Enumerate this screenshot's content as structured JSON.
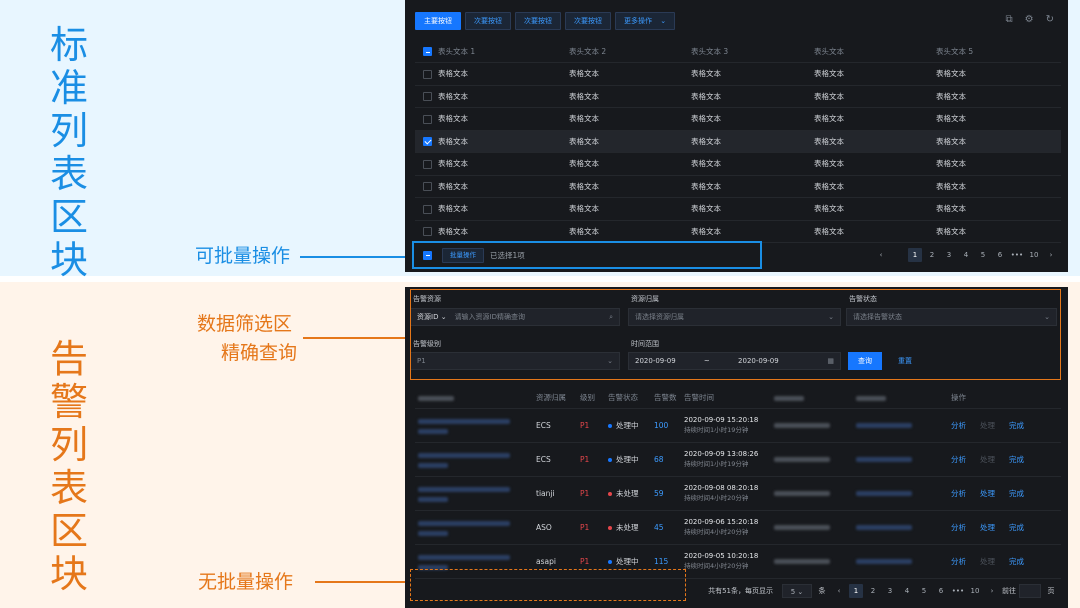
{
  "labels": {
    "standard_title": [
      "标",
      "准",
      "列",
      "表",
      "区",
      "块"
    ],
    "alert_title": [
      "告",
      "警",
      "列",
      "表",
      "区",
      "块"
    ],
    "batch_annotation": "可批量操作",
    "filter_annotation_1": "数据筛选区",
    "filter_annotation_2": "精确查询",
    "no_batch_annotation": "无批量操作"
  },
  "colors": {
    "blue_accent": "#1a8ee4",
    "orange_accent": "#e5771a",
    "primary": "#1677ff",
    "danger": "#e4464b",
    "panel_bg": "#17191d"
  },
  "standard": {
    "toolbar": {
      "primary": "主要按钮",
      "secondary": [
        "次要按钮",
        "次要按钮",
        "次要按钮"
      ],
      "more": "更多操作"
    },
    "toolbar_icons": [
      "export-icon",
      "settings-icon",
      "refresh-icon"
    ],
    "headers": [
      "表头文本 1",
      "表头文本 2",
      "表头文本 3",
      "表头文本",
      "表头文本 5"
    ],
    "rows": [
      {
        "checked": false,
        "cells": [
          "表格文本",
          "表格文本",
          "表格文本",
          "表格文本",
          "表格文本"
        ]
      },
      {
        "checked": false,
        "cells": [
          "表格文本",
          "表格文本",
          "表格文本",
          "表格文本",
          "表格文本"
        ]
      },
      {
        "checked": false,
        "cells": [
          "表格文本",
          "表格文本",
          "表格文本",
          "表格文本",
          "表格文本"
        ]
      },
      {
        "checked": true,
        "cells": [
          "表格文本",
          "表格文本",
          "表格文本",
          "表格文本",
          "表格文本"
        ]
      },
      {
        "checked": false,
        "cells": [
          "表格文本",
          "表格文本",
          "表格文本",
          "表格文本",
          "表格文本"
        ]
      },
      {
        "checked": false,
        "cells": [
          "表格文本",
          "表格文本",
          "表格文本",
          "表格文本",
          "表格文本"
        ]
      },
      {
        "checked": false,
        "cells": [
          "表格文本",
          "表格文本",
          "表格文本",
          "表格文本",
          "表格文本"
        ]
      },
      {
        "checked": false,
        "cells": [
          "表格文本",
          "表格文本",
          "表格文本",
          "表格文本",
          "表格文本"
        ]
      }
    ],
    "bulk": {
      "button": "批量操作",
      "selected_info": "已选择1项"
    },
    "pager": {
      "prev": "‹",
      "pages": [
        "1",
        "2",
        "3",
        "4",
        "5",
        "6"
      ],
      "ellipsis": "•••",
      "last": "10",
      "next": "›"
    }
  },
  "alert": {
    "filters": {
      "resource_label": "告警资源",
      "resource_type": "资源ID",
      "resource_placeholder": "请输入资源ID精确查询",
      "ownership_label": "资源归属",
      "ownership_placeholder": "请选择资源归属",
      "status_label": "告警状态",
      "status_placeholder": "请选择告警状态",
      "level_label": "告警级别",
      "level_value": "P1",
      "time_label": "时间范围",
      "time_start": "2020-09-09",
      "time_sep": "~",
      "time_end": "2020-09-09",
      "query": "查询",
      "reset": "重置"
    },
    "headers": [
      "资源归属",
      "级别",
      "告警状态",
      "告警数",
      "告警时间",
      "操作"
    ],
    "rows": [
      {
        "owner": "ECS",
        "level": "P1",
        "status": "处理中",
        "status_color": "#1677ff",
        "count": "100",
        "time": "2020-09-09 15:20:18",
        "duration": "持续时间1小时19分钟",
        "op_handle_enabled": false
      },
      {
        "owner": "ECS",
        "level": "P1",
        "status": "处理中",
        "status_color": "#1677ff",
        "count": "68",
        "time": "2020-09-09 13:08:26",
        "duration": "持续时间1小时19分钟",
        "op_handle_enabled": false
      },
      {
        "owner": "tianji",
        "level": "P1",
        "status": "未处理",
        "status_color": "#e4464b",
        "count": "59",
        "time": "2020-09-08 08:20:18",
        "duration": "持续时间4小时20分钟",
        "op_handle_enabled": true
      },
      {
        "owner": "ASO",
        "level": "P1",
        "status": "未处理",
        "status_color": "#e4464b",
        "count": "45",
        "time": "2020-09-06 15:20:18",
        "duration": "持续时间4小时20分钟",
        "op_handle_enabled": true
      },
      {
        "owner": "asapi",
        "level": "P1",
        "status": "处理中",
        "status_color": "#1677ff",
        "count": "115",
        "time": "2020-09-05 10:20:18",
        "duration": "持续时间4小时20分钟",
        "op_handle_enabled": false
      }
    ],
    "ops": {
      "analyze": "分析",
      "handle": "处理",
      "done": "完成"
    },
    "pager": {
      "total": "共有51条，每页显示",
      "size": "5",
      "unit": "条",
      "prev": "‹",
      "pages": [
        "1",
        "2",
        "3",
        "4",
        "5",
        "6"
      ],
      "ellipsis": "•••",
      "last": "10",
      "next": "›",
      "goto": "前往",
      "page_suffix": "页"
    }
  }
}
